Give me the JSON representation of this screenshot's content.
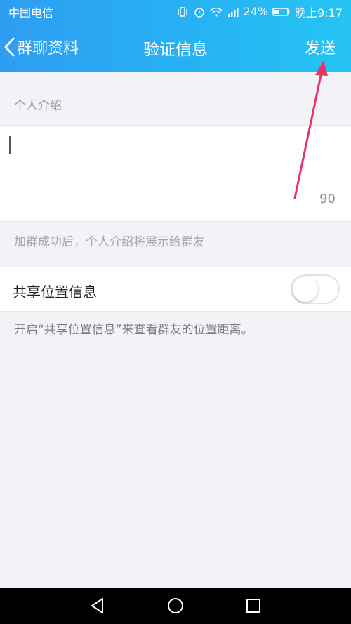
{
  "status_bar": {
    "carrier": "中国电信",
    "battery": "24%",
    "time": "晚上9:17"
  },
  "nav": {
    "back_label": "群聊资料",
    "title": "验证信息",
    "send_label": "发送"
  },
  "intro": {
    "section_label": "个人介绍",
    "counter": "90",
    "hint": "加群成功后，个人介绍将展示给群友"
  },
  "share_location": {
    "label": "共享位置信息",
    "enabled": false,
    "hint": "开启“共享位置信息”来查看群友的位置距离。"
  },
  "colors": {
    "header_start": "#2f9df2",
    "header_end": "#26c4f3",
    "annotation_arrow": "#e8336b"
  },
  "icons": [
    "vibrate-icon",
    "alarm-icon",
    "wifi-icon",
    "signal-icon",
    "battery-icon",
    "back-chevron-icon",
    "nav-back-icon",
    "nav-home-icon",
    "nav-recents-icon"
  ]
}
